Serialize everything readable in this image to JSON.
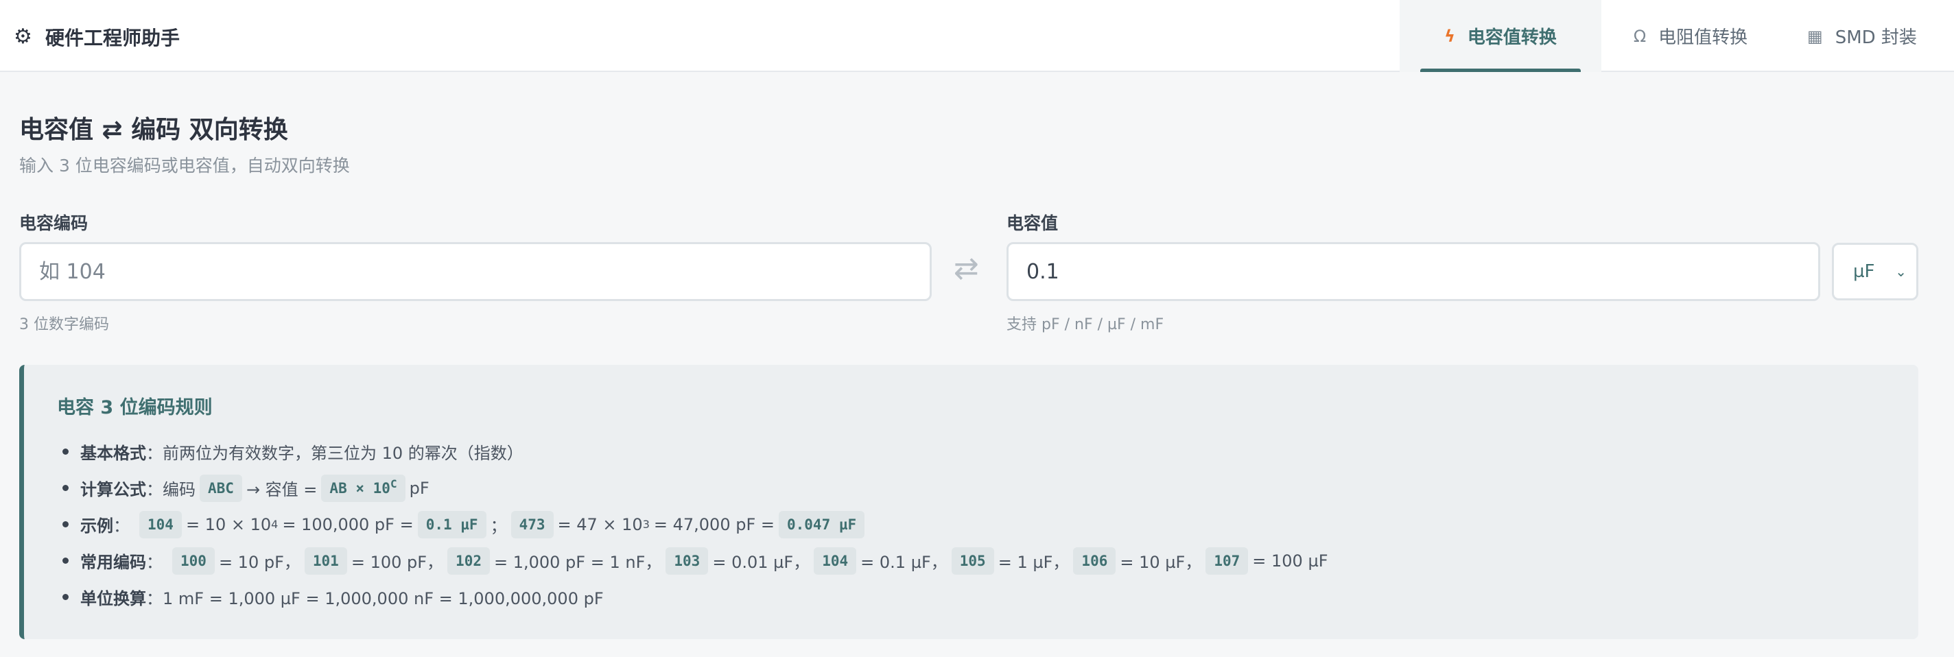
{
  "header": {
    "brand_icon": "gear-icon",
    "brand_title": "硬件工程师助手",
    "tabs": [
      {
        "icon": "lightning-icon",
        "label": "电容值转换",
        "active": true
      },
      {
        "icon": "omega-icon",
        "label": "电阻值转换",
        "active": false
      },
      {
        "icon": "grid-icon",
        "label": "SMD 封装",
        "active": false
      }
    ]
  },
  "main": {
    "title": "电容值 ⇄ 编码 双向转换",
    "subtitle": "输入 3 位电容编码或电容值，自动双向转换",
    "code_field": {
      "label": "电容编码",
      "placeholder": "如 104",
      "hint": "3 位数字编码"
    },
    "value_field": {
      "label": "电容值",
      "value": "0.1",
      "hint": "支持 pF / nF / µF / mF"
    },
    "unit_select": {
      "selected": "µF"
    }
  },
  "rules": {
    "title": "电容 3 位编码规则",
    "basic": {
      "label": "基本格式",
      "text": "：前两位为有效数字，第三位为 10 的幂次（指数）"
    },
    "formula": {
      "label": "计算公式",
      "t1": "：编码",
      "c1": "ABC",
      "t2": "→ 容值 =",
      "c2": "AB × 10",
      "c2_sup": "C",
      "t3": "pF"
    },
    "example": {
      "label": "示例",
      "sep": "：",
      "c1": "104",
      "t1a": "= 10 × 10",
      "t1sup": "4",
      "t1b": "= 100,000 pF =",
      "c1v": "0.1 µF",
      "mid": "；",
      "c2": "473",
      "t2a": "= 47 × 10",
      "t2sup": "3",
      "t2b": "= 47,000 pF =",
      "c2v": "0.047 µF"
    },
    "common": {
      "label": "常用编码",
      "sep": "：",
      "items": [
        {
          "code": "100",
          "value": "= 10 pF，"
        },
        {
          "code": "101",
          "value": "= 100 pF，"
        },
        {
          "code": "102",
          "value": "= 1,000 pF = 1 nF，"
        },
        {
          "code": "103",
          "value": "= 0.01 µF，"
        },
        {
          "code": "104",
          "value": "= 0.1 µF，"
        },
        {
          "code": "105",
          "value": "= 1 µF，"
        },
        {
          "code": "106",
          "value": "= 10 µF，"
        },
        {
          "code": "107",
          "value": "= 100 µF"
        }
      ]
    },
    "units": {
      "label": "单位换算",
      "text": "：1 mF = 1,000 µF = 1,000,000 nF = 1,000,000,000 pF"
    }
  }
}
